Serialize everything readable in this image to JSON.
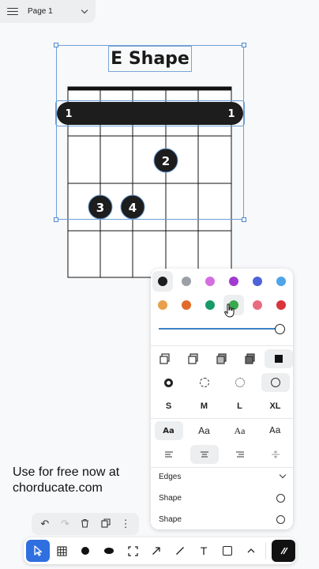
{
  "page_selector": {
    "label": "Page 1"
  },
  "chord": {
    "title": "E Shape",
    "barre_left": "1",
    "barre_right": "1",
    "fingers": [
      "2",
      "3",
      "4"
    ]
  },
  "style_panel": {
    "colors": [
      "#1d1d1d",
      "#9aa0a6",
      "#d46ee0",
      "#a23ad0",
      "#4d63d8",
      "#4ea4e8",
      "#e8a04c",
      "#e06a28",
      "#169a68",
      "#3aa84c",
      "#e86c80",
      "#d8343c"
    ],
    "selected_color": "#1d1d1d",
    "size_options": [
      "S",
      "M",
      "L",
      "XL"
    ],
    "font_options": [
      "Aa",
      "Aa",
      "Aa",
      "Aa"
    ],
    "edges_label": "Edges",
    "shape_label_1": "Shape",
    "shape_label_2": "Shape"
  },
  "promo": {
    "line1": "Use for free now at",
    "line2": "chorducate.com"
  },
  "toolbar": {
    "tools": [
      "select-tool",
      "grid-tool",
      "dot-tool",
      "oval-tool",
      "frame-tool",
      "arrow-tool",
      "line-tool",
      "text-tool",
      "rectangle-tool",
      "more-tool",
      "magic-tool"
    ],
    "text_tool_label": "T"
  }
}
